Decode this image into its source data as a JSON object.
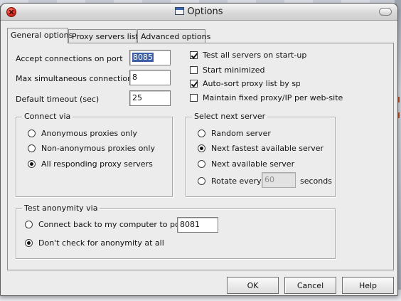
{
  "window": {
    "title": "Options"
  },
  "tabs": [
    {
      "label": "General options",
      "active": true
    },
    {
      "label": "Proxy servers list",
      "active": false
    },
    {
      "label": "Advanced options",
      "active": false
    }
  ],
  "general": {
    "port_label": "Accept connections on port",
    "port_value": "8085",
    "max_conn_label": "Max simultaneous connections",
    "max_conn_value": "8",
    "timeout_label": "Default timeout (sec)",
    "timeout_value": "25"
  },
  "checkboxes": [
    {
      "label": "Test all servers on start-up",
      "checked": true
    },
    {
      "label": "Start minimized",
      "checked": false
    },
    {
      "label": "Auto-sort proxy list by speec",
      "checked": true
    },
    {
      "label": "Maintain fixed proxy/IP per web-site",
      "checked": false
    }
  ],
  "connect_via": {
    "title": "Connect via",
    "options": [
      {
        "label": "Anonymous proxies only",
        "selected": false
      },
      {
        "label": "Non-anonymous proxies only",
        "selected": false
      },
      {
        "label": "All responding proxy servers",
        "selected": true
      }
    ]
  },
  "next_server": {
    "title": "Select next server",
    "options": [
      {
        "label": "Random server",
        "selected": false
      },
      {
        "label": "Next fastest available server",
        "selected": true
      },
      {
        "label": "Next available server",
        "selected": false
      },
      {
        "label": "Rotate every",
        "selected": false
      }
    ],
    "rotate_value": "60",
    "rotate_unit": "seconds"
  },
  "anonymity": {
    "title": "Test anonymity via",
    "connect_back_label": "Connect back to my computer to port #",
    "connect_back_port": "8081",
    "dont_check_label": "Don't check for anonymity at all",
    "selected": "dont_check"
  },
  "buttons": {
    "ok": "OK",
    "cancel": "Cancel",
    "help": "Help"
  },
  "colors": {
    "close_button": "#d3261b",
    "selection": "#3d5fa8"
  }
}
